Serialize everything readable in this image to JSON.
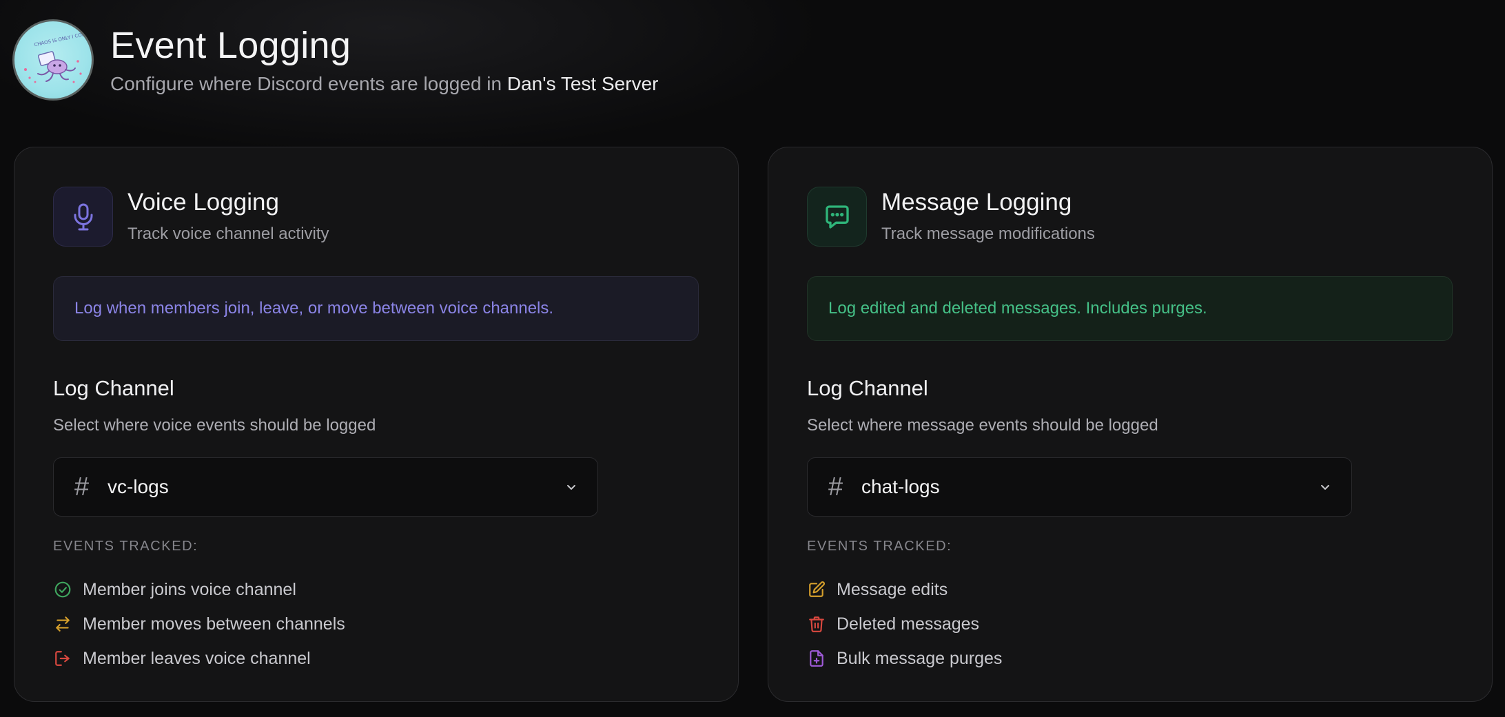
{
  "header": {
    "title": "Event Logging",
    "subtitle_prefix": "Configure where Discord events are logged in",
    "server_name": "Dan's Test Server",
    "avatar_text": "CHAOS IS ONLY I COME"
  },
  "voice": {
    "title": "Voice Logging",
    "description": "Track voice channel activity",
    "info": "Log when members join, leave, or move between voice channels.",
    "log_channel_title": "Log Channel",
    "log_channel_desc": "Select where voice events should be logged",
    "channel_hash": "#",
    "selected_channel": "vc-logs",
    "events_label": "EVENTS TRACKED:",
    "events": [
      {
        "label": "Member joins voice channel",
        "icon": "check-circle-icon",
        "color": "#3fa65e"
      },
      {
        "label": "Member moves between channels",
        "icon": "arrows-swap-icon",
        "color": "#d6a02c"
      },
      {
        "label": "Member leaves voice channel",
        "icon": "logout-icon",
        "color": "#d9483f"
      }
    ],
    "accent": "#7c74e0"
  },
  "message": {
    "title": "Message Logging",
    "description": "Track message modifications",
    "info": "Log edited and deleted messages. Includes purges.",
    "log_channel_title": "Log Channel",
    "log_channel_desc": "Select where message events should be logged",
    "channel_hash": "#",
    "selected_channel": "chat-logs",
    "events_label": "EVENTS TRACKED:",
    "events": [
      {
        "label": "Message edits",
        "icon": "edit-icon",
        "color": "#d6a02c"
      },
      {
        "label": "Deleted messages",
        "icon": "trash-icon",
        "color": "#d9483f"
      },
      {
        "label": "Bulk message purges",
        "icon": "file-plus-icon",
        "color": "#9f5ad8"
      }
    ],
    "accent": "#2fb57a"
  }
}
